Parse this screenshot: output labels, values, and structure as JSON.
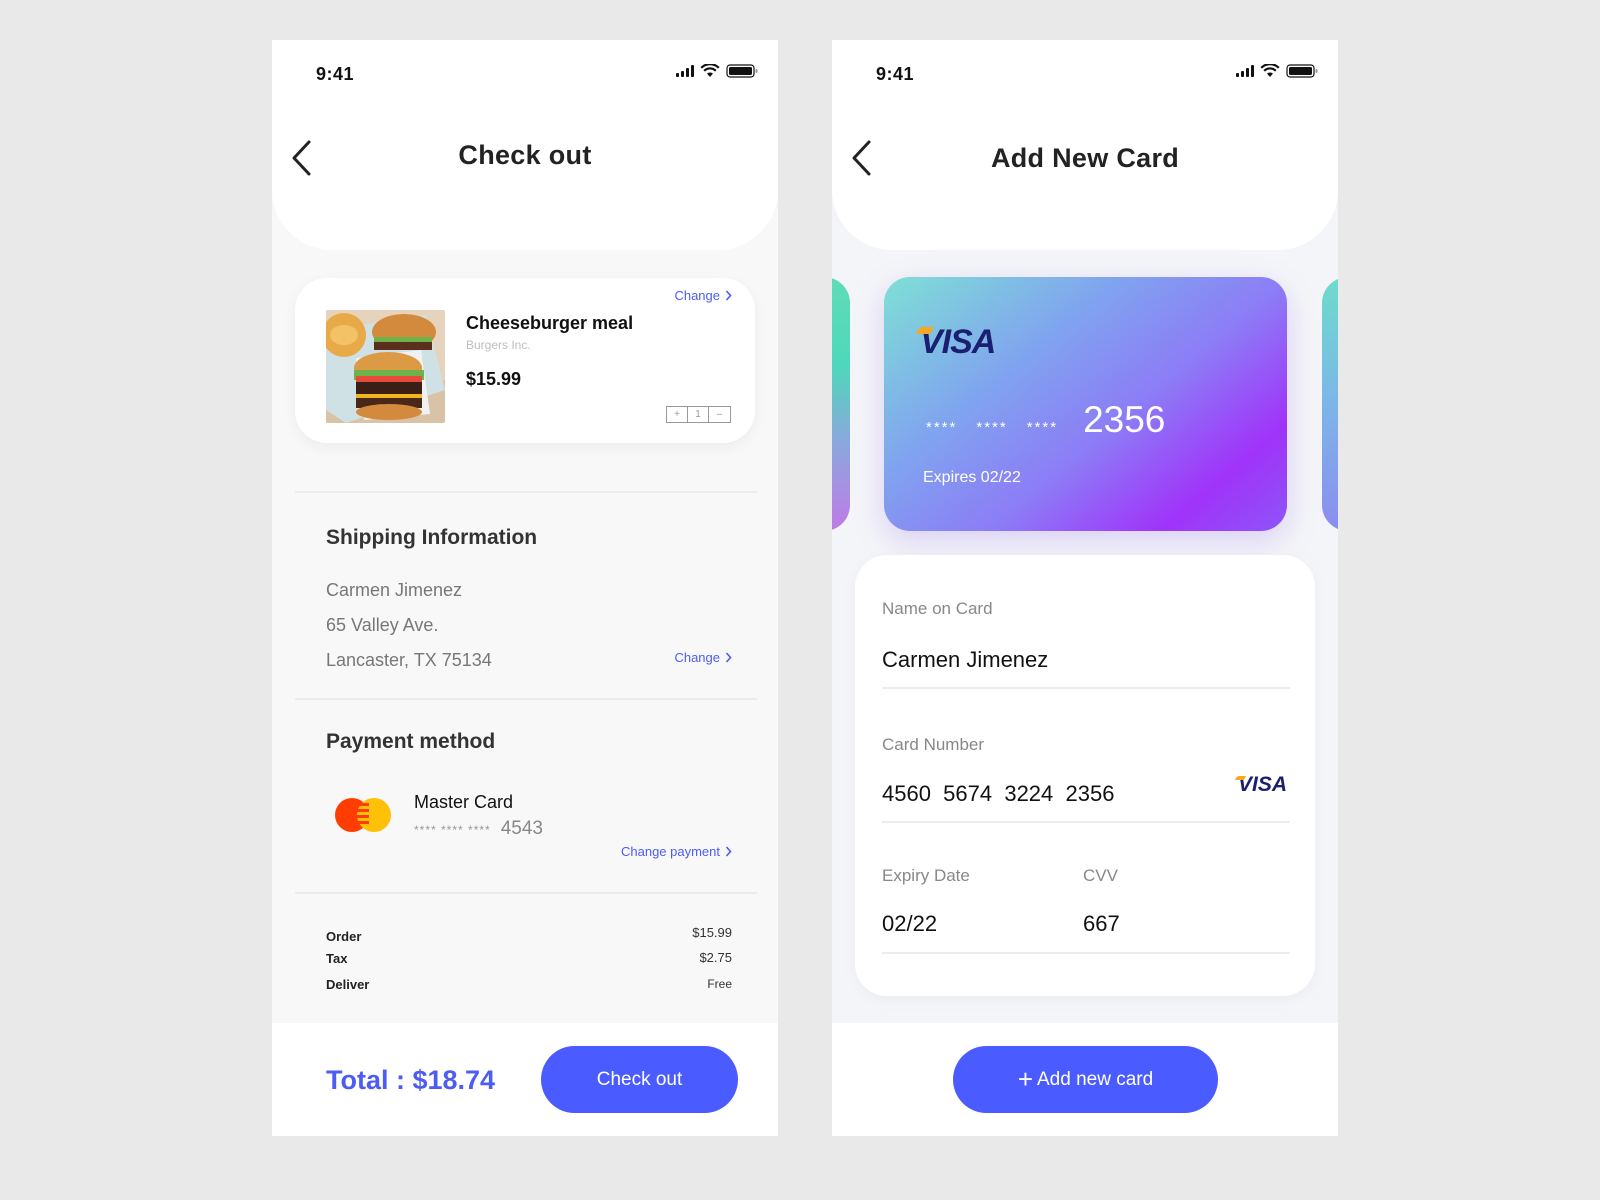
{
  "checkout_screen": {
    "status_bar": {
      "time": "9:41"
    },
    "title": "Check out",
    "item": {
      "name": "Cheeseburger meal",
      "vendor": "Burgers Inc.",
      "price": "$15.99",
      "change_label": "Change",
      "quantity": "1",
      "increment_label": "+",
      "decrement_label": "–"
    },
    "shipping": {
      "title": "Shipping Information",
      "name": "Carmen Jimenez",
      "street": "65 Valley Ave.",
      "city": "Lancaster, TX 75134",
      "change_label": "Change"
    },
    "payment": {
      "title": "Payment method",
      "card_name": "Master Card",
      "masked": "**** **** ****",
      "last4": "4543",
      "change_label": "Change payment"
    },
    "summary": [
      {
        "label": "Order",
        "value": "$15.99"
      },
      {
        "label": "Tax",
        "value": "$2.75"
      },
      {
        "label": "Deliver",
        "value": "Free"
      }
    ],
    "total": "Total : $18.74",
    "checkout_button": "Check out"
  },
  "add_card_screen": {
    "status_bar": {
      "time": "9:41"
    },
    "title": "Add New Card",
    "card_preview": {
      "brand": "VISA",
      "masked_groups": [
        "****",
        "****",
        "****"
      ],
      "last4": "2356",
      "expires": "Expires 02/22"
    },
    "form": {
      "name_label": "Name on Card",
      "name_value": "Carmen Jimenez",
      "number_label": "Card Number",
      "number_value": "4560  5674  3224  2356",
      "number_brand": "VISA",
      "expiry_label": "Expiry Date",
      "expiry_value": "02/22",
      "cvv_label": "CVV",
      "cvv_value": "667"
    },
    "add_button": {
      "icon": "+",
      "label": "Add new card"
    }
  },
  "colors": {
    "accent": "#4a5cff",
    "link": "#4c5cf5",
    "visa_navy": "#1a1f71",
    "mastercard_red": "#ff3d00",
    "mastercard_yellow": "#ffc107"
  }
}
